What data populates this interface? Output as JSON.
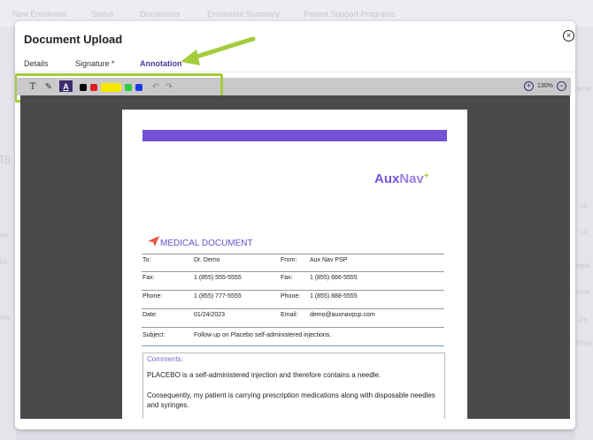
{
  "background": {
    "nav": [
      "New Enrolment",
      "Status",
      "Documents",
      "Enrolment Summary",
      "Patient Support Programs"
    ],
    "fragments": [
      "ts",
      "Ur",
      "Ur",
      "ame",
      "egra",
      "bil",
      "ne",
      "me",
      "ssee",
      "Ph",
      "Physi",
      "Noe",
      "Pate",
      "Ba",
      "ssee",
      "Ph",
      "Re",
      "Ph",
      "Physi",
      "Fa",
      "nen"
    ]
  },
  "modal": {
    "title": "Document Upload",
    "close_glyph": "×",
    "tabs": [
      {
        "label": "Details"
      },
      {
        "label": "Signature *"
      },
      {
        "label": "Annotation",
        "active": true
      }
    ]
  },
  "toolbar": {
    "tools": [
      {
        "name": "text-tool",
        "glyph": "T"
      },
      {
        "name": "draw-tool",
        "glyph": "✎"
      },
      {
        "name": "highlight-text-tool",
        "glyph": "A"
      }
    ],
    "colors": [
      "#000000",
      "#e01c1c",
      "#f5e900",
      "#2ecc40",
      "#1a3ae0"
    ],
    "undo_glyph": "↶",
    "redo_glyph": "↷",
    "zoom_in_glyph": "+",
    "zoom_level": "130%",
    "zoom_out_glyph": "−",
    "highlight_color": "#a3cc3c"
  },
  "document": {
    "logo": {
      "aux": "Aux",
      "nav": "Nav",
      "plus": "+"
    },
    "title": "MEDICAL DOCUMENT",
    "rows": [
      {
        "l1": "To:",
        "v1": "Dr. Demo",
        "l2": "From:",
        "v2": "Aux Nav PSP"
      },
      {
        "l1": "Fax:",
        "v1": "1 (855) 555-5555",
        "l2": "Fax:",
        "v2": "1 (855) 666-5555"
      },
      {
        "l1": "Phone:",
        "v1": "1 (855) 777-5555",
        "l2": "Phone:",
        "v2": "1 (855) 888-5555"
      },
      {
        "l1": "Date:",
        "v1": "01/24/2023",
        "l2": "Email:",
        "v2": "demo@auxnavpsp.com"
      }
    ],
    "subject_label": "Subject:",
    "subject": "Follow up on Placebo self-administered injections.",
    "comments_label": "Comments:",
    "comment1": "PLACEBO is a self-administered injection and therefore contains a needle.",
    "comment2": "Consequently, my patient is carrying prescription medications along with disposable needles and syringes."
  }
}
